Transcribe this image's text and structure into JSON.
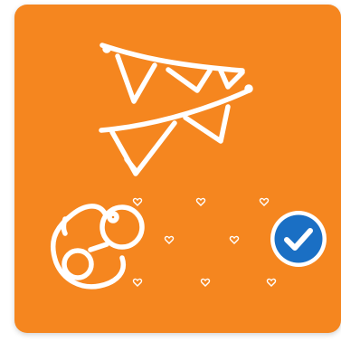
{
  "card": {
    "background": "#f5861f",
    "line_color": "#ffffff",
    "icons": {
      "garland": "bunting-garland-icon",
      "pacifier": "baby-pacifier-icon",
      "hearts": "heart-icon",
      "selected": "check-circle-icon"
    },
    "selected": true,
    "check_color": "#1a6fc4"
  }
}
